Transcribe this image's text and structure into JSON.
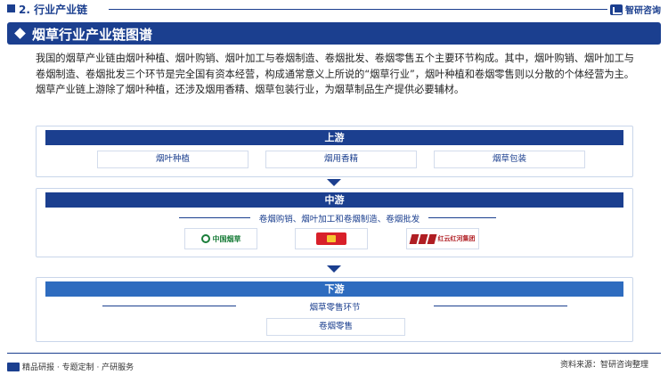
{
  "header": {
    "section_title": "2. 行业产业链",
    "brand": "智研咨询"
  },
  "banner": {
    "title": "烟草行业产业链图谱"
  },
  "intro": "我国的烟草产业链由烟叶种植、烟叶购销、烟叶加工与卷烟制造、卷烟批发、卷烟零售五个主要环节构成。其中，烟叶购销、烟叶加工与卷烟制造、卷烟批发三个环节是完全国有资本经营，构成通常意义上所说的“烟草行业”，烟叶种植和卷烟零售则以分散的个体经营为主。烟草产业链上游除了烟叶种植，还涉及烟用香精、烟草包装行业，为烟草制品生产提供必要辅材。",
  "upstream": {
    "title": "上游",
    "items": [
      "烟叶种植",
      "烟用香精",
      "烟草包装"
    ]
  },
  "midstream": {
    "title": "中游",
    "label": "卷烟购销、烟叶加工和卷烟制造、卷烟批发",
    "logos": [
      {
        "text": "中国烟草",
        "icon": "china-tobacco-logo"
      },
      {
        "text": "",
        "icon": "red-brand-logo"
      },
      {
        "text": "红云红河集团",
        "icon": "hongyun-honghe-logo"
      }
    ]
  },
  "downstream": {
    "title": "下游",
    "label": "烟草零售环节",
    "items": [
      "卷烟零售"
    ]
  },
  "footer": {
    "left": "精品研报 · 专题定制 · 产研服务",
    "right": "资料来源：智研咨询整理"
  },
  "colors": {
    "primary": "#1b3f8f",
    "light": "#2e6cbf"
  }
}
